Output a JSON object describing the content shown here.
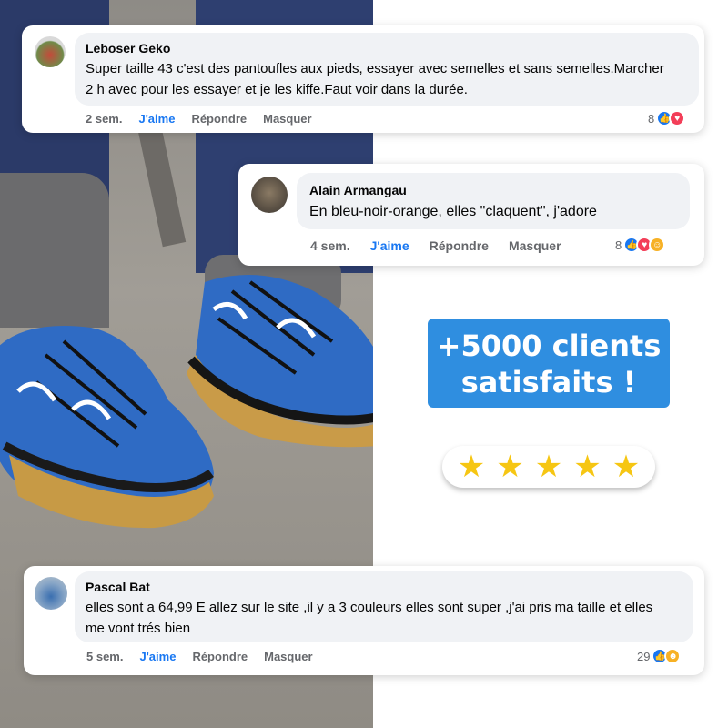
{
  "comments": [
    {
      "author": "Leboser Geko",
      "text": "Super taille 43 c'est des pantoufles aux pieds, essayer avec semelles et sans semelles.Marcher 2 h avec pour les essayer et je les kiffe.Faut voir dans la durée.",
      "time": "2 sem.",
      "like": "J'aime",
      "reply": "Répondre",
      "hide": "Masquer",
      "reaction_count": "8",
      "reactions": [
        "like-icon",
        "love-icon"
      ]
    },
    {
      "author": "Alain Armangau",
      "text": "En bleu-noir-orange, elles \"claquent\", j'adore",
      "time": "4 sem.",
      "like": "J'aime",
      "reply": "Répondre",
      "hide": "Masquer",
      "reaction_count": "8",
      "reactions": [
        "like-icon",
        "love-icon",
        "care-icon"
      ]
    },
    {
      "author": "Pascal Bat",
      "text": "elles sont a 64,99 E allez sur le site ,il y a 3 couleurs elles sont super ,j'ai pris ma taille et elles me vont trés bien",
      "time": "5 sem.",
      "like": "J'aime",
      "reply": "Répondre",
      "hide": "Masquer",
      "reaction_count": "29",
      "reactions": [
        "like-icon",
        "laugh-icon"
      ]
    }
  ],
  "badge": {
    "line1": "+5000 clients",
    "line2": "satisfaits !"
  },
  "rating": {
    "stars": 5,
    "max": 5
  },
  "colors": {
    "facebook_blue": "#1877f2",
    "badge_blue": "#2f8ee0",
    "star_yellow": "#f6c613"
  }
}
